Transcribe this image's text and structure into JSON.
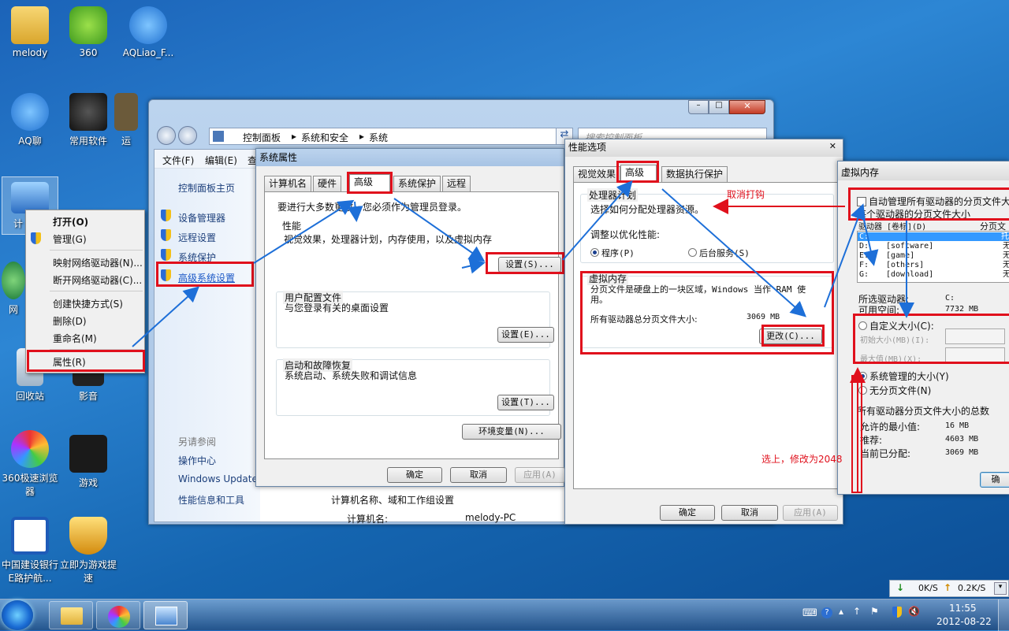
{
  "desktop": {
    "icons": [
      {
        "label": "melody"
      },
      {
        "label": "360"
      },
      {
        "label": "AQLiao_F..."
      },
      {
        "label": "AQ聊"
      },
      {
        "label": "常用软件"
      },
      {
        "label": "运"
      },
      {
        "label": "计"
      },
      {
        "label": "网"
      },
      {
        "label": "回收站"
      },
      {
        "label": "影音"
      },
      {
        "label": "360极速浏览器"
      },
      {
        "label": "游戏"
      },
      {
        "label": "中国建设银行E路护航..."
      },
      {
        "label": "立即为游戏提速"
      }
    ]
  },
  "context_menu": {
    "items": [
      "打开(O)",
      "管理(G)",
      "映射网络驱动器(N)...",
      "断开网络驱动器(C)...",
      "创建快捷方式(S)",
      "删除(D)",
      "重命名(M)",
      "属性(R)"
    ]
  },
  "explorer": {
    "breadcrumb": [
      "控制面板",
      "系统和安全",
      "系统"
    ],
    "search_placeholder": "搜索控制面板",
    "menu": [
      "文件(F)",
      "编辑(E)",
      "查"
    ],
    "sidebar_title": "控制面板主页",
    "sidebar_links": [
      "设备管理器",
      "远程设置",
      "系统保护",
      "高级系统设置"
    ],
    "see_also_title": "另请参阅",
    "see_also": [
      "操作中心",
      "Windows Update",
      "性能信息和工具"
    ],
    "bottom_heading": "计算机名称、域和工作组设置",
    "computer_name_label": "计算机名:",
    "computer_name_value": "melody-PC"
  },
  "sysprops": {
    "title": "系统属性",
    "tabs": [
      "计算机名",
      "硬件",
      "高级",
      "系统保护",
      "远程"
    ],
    "admin_note": "要进行大多数更改，您必须作为管理员登录。",
    "perf_title": "性能",
    "perf_desc": "视觉效果，处理器计划，内存使用，以及虚拟内存",
    "perf_btn": "设置(S)...",
    "profile_title": "用户配置文件",
    "profile_desc": "与您登录有关的桌面设置",
    "profile_btn": "设置(E)...",
    "startup_title": "启动和故障恢复",
    "startup_desc": "系统启动、系统失败和调试信息",
    "startup_btn": "设置(T)...",
    "env_btn": "环境变量(N)...",
    "ok": "确定",
    "cancel": "取消",
    "apply": "应用(A)"
  },
  "perfopts": {
    "title": "性能选项",
    "tabs": [
      "视觉效果",
      "高级",
      "数据执行保护"
    ],
    "sched_title": "处理器计划",
    "sched_desc": "选择如何分配处理器资源。",
    "adjust_label": "调整以优化性能:",
    "opt_programs": "程序(P)",
    "opt_services": "后台服务(S)",
    "vm_title": "虚拟内存",
    "vm_desc": "分页文件是硬盘上的一块区域，Windows 当作 RAM 使用。",
    "vm_total_label": "所有驱动器总分页文件大小:",
    "vm_total_value": "3069 MB",
    "change_btn": "更改(C)...",
    "ok": "确定",
    "cancel": "取消",
    "apply": "应用(A)"
  },
  "vmem": {
    "title": "虚拟内存",
    "auto_manage": "自动管理所有驱动器的分页文件大",
    "per_drive": "每个驱动器的分页文件大小",
    "col_drive": "驱动器 [卷标](D)",
    "col_size": "分页文",
    "drives": [
      {
        "drive": "C:",
        "label": "",
        "size": "托"
      },
      {
        "drive": "D:",
        "label": "[software]",
        "size": "无"
      },
      {
        "drive": "E:",
        "label": "[game]",
        "size": "无"
      },
      {
        "drive": "F:",
        "label": "[others]",
        "size": "无"
      },
      {
        "drive": "G:",
        "label": "[download]",
        "size": "无"
      }
    ],
    "selected_drive_label": "所选驱动器:",
    "selected_drive_value": "C:",
    "free_space_label": "可用空间:",
    "free_space_value": "7732 MB",
    "custom_size": "自定义大小(C):",
    "initial_size": "初始大小(MB)(I):",
    "max_size": "最大值(MB)(X):",
    "system_managed": "系统管理的大小(Y)",
    "no_paging": "无分页文件(N)",
    "totals_title": "所有驱动器分页文件大小的总数",
    "min_label": "允许的最小值:",
    "min_value": "16 MB",
    "rec_label": "推荐:",
    "rec_value": "4603 MB",
    "cur_label": "当前已分配:",
    "cur_value": "3069 MB",
    "set_btn": "确"
  },
  "annotations": {
    "uncheck": "取消打钩",
    "select_modify": "选上，修改为2048"
  },
  "taskbar": {
    "net_down": "0K/S",
    "net_up": "0.2K/S",
    "time": "11:55",
    "date": "2012-08-22"
  }
}
